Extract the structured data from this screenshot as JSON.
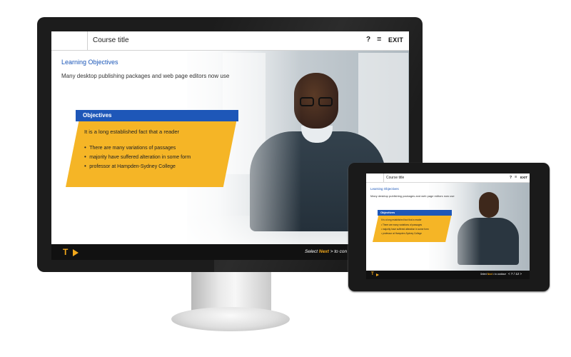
{
  "desktop": {
    "header": {
      "course_title": "Course title",
      "help_label": "?",
      "menu_label": "≡",
      "exit_label": "EXIT"
    },
    "content": {
      "heading": "Learning Objectives",
      "intro": "Many desktop publishing packages and web page editors now use",
      "objectives": {
        "title": "Objectives",
        "lead": "It is a long established fact that a reader",
        "bullets": [
          "There are many variations of passages",
          "majority have suffered alteration in some form",
          "professor at Hampden-Sydney College"
        ]
      }
    },
    "footer": {
      "t_label": "T",
      "select_prefix": "Select ",
      "next_label": "Next",
      "select_suffix": " > to con"
    }
  },
  "tablet": {
    "header": {
      "course_title": "Course title",
      "help_label": "?",
      "menu_label": "≡",
      "exit_label": "EXIT"
    },
    "content": {
      "heading": "Learning Objectives",
      "intro": "Many desktop publishing packages and web page editors now use",
      "objectives": {
        "title": "Objectives",
        "lead": "It is a long established fact that a reader",
        "bullets": [
          "There are many variations of passages",
          "majority have suffered alteration in some form",
          "professor at Hampden-Sydney College"
        ]
      }
    },
    "footer": {
      "t_label": "T",
      "select_prefix": "Select ",
      "next_label": "Next",
      "select_suffix": " > to continue",
      "page_indicator": "< 7 / 12 >"
    }
  },
  "colors": {
    "accent_blue": "#1e57b8",
    "accent_yellow": "#f5b526",
    "footer_bg": "#111111",
    "footer_accent": "#f2a81c"
  }
}
